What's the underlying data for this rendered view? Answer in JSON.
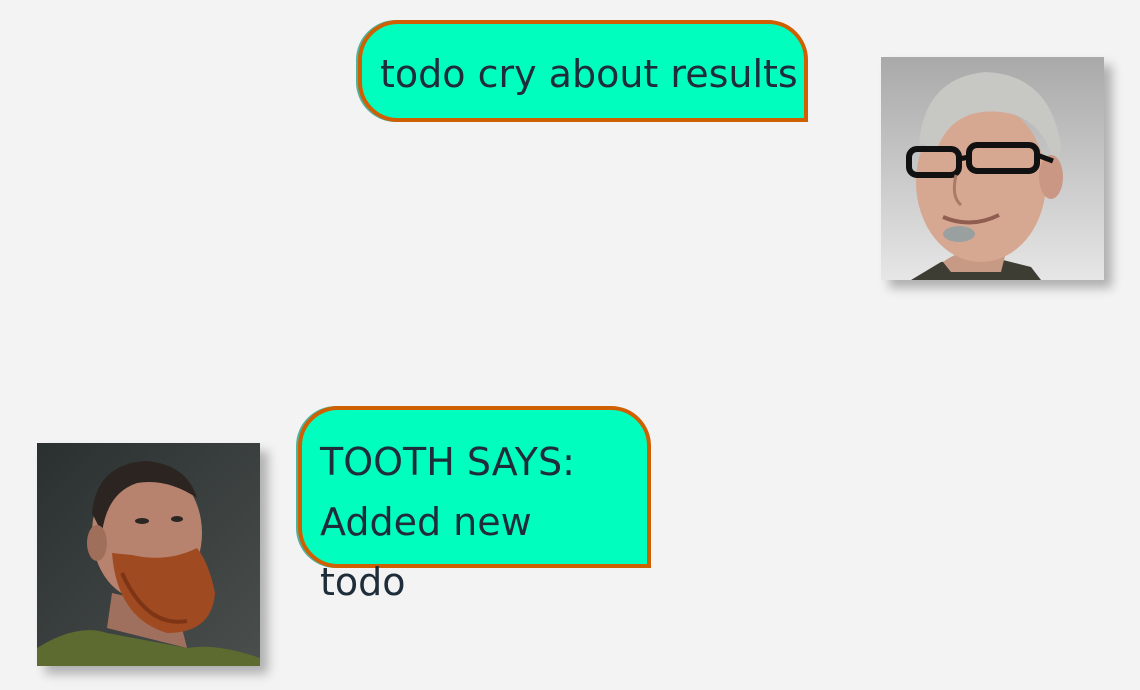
{
  "messages": [
    {
      "sender": "user",
      "text": "todo cry about results",
      "avatar": "avatar-older-man-glasses"
    },
    {
      "sender": "bot",
      "lines": [
        "TOOTH SAYS:",
        "Added new todo"
      ],
      "avatar": "avatar-bearded-man"
    }
  ],
  "colors": {
    "background": "#f3f3f3",
    "bubble_fill": "#00ffbe",
    "bubble_border": "#cf5f00",
    "text": "#1f2d3a"
  }
}
